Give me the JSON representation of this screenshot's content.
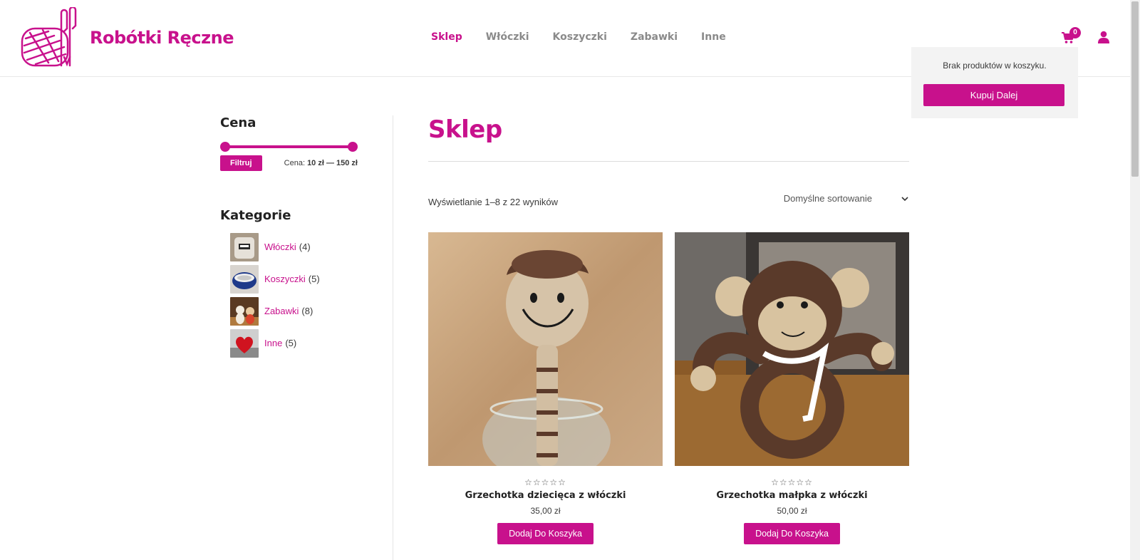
{
  "header": {
    "site_title": "Robótki Ręczne",
    "nav": [
      {
        "label": "Sklep",
        "active": true
      },
      {
        "label": "Włóczki",
        "active": false
      },
      {
        "label": "Koszyczki",
        "active": false
      },
      {
        "label": "Zabawki",
        "active": false
      },
      {
        "label": "Inne",
        "active": false
      }
    ],
    "cart_count": "0",
    "icons": {
      "cart": "cart-icon",
      "user": "user-icon",
      "logo": "yarn-logo-icon"
    }
  },
  "mini_cart": {
    "empty_text": "Brak produktów w koszyku.",
    "button_label": "Kupuj Dalej"
  },
  "sidebar": {
    "price_widget": {
      "title": "Cena",
      "filter_label": "Filtruj",
      "price_prefix": "Cena:",
      "price_range": "10 zł — 150 zł"
    },
    "categories_widget": {
      "title": "Kategorie",
      "items": [
        {
          "name": "Włóczki",
          "count": "(4)"
        },
        {
          "name": "Koszyczki",
          "count": "(5)"
        },
        {
          "name": "Zabawki",
          "count": "(8)"
        },
        {
          "name": "Inne",
          "count": "(5)"
        }
      ]
    }
  },
  "main": {
    "page_title": "Sklep",
    "result_count": "Wyświetlanie 1–8 z 22 wyników",
    "sort_label": "Domyślne sortowanie",
    "products": [
      {
        "name": "Grzechotka dziecięca z włóczki",
        "price": "35,00 zł",
        "rating": 0,
        "button": "Dodaj Do Koszyka"
      },
      {
        "name": "Grzechotka małpka z włóczki",
        "price": "50,00 zł",
        "rating": 0,
        "button": "Dodaj Do Koszyka"
      }
    ]
  },
  "colors": {
    "accent": "#c8118c",
    "text": "#3a3a3a",
    "muted": "#8a8a8a"
  }
}
